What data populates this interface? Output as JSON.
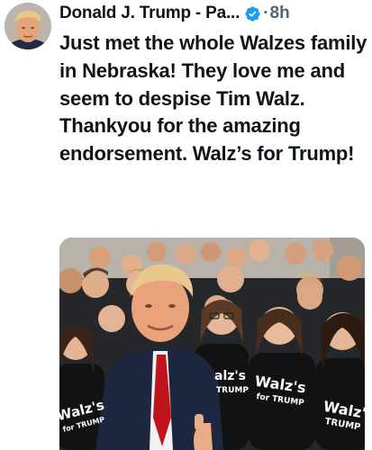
{
  "post": {
    "author_name": "Donald J. Trump - Pa...",
    "separator": "·",
    "timestamp": "8h",
    "text": "Just met the whole Walzes family in Nebraska! They love me and seem to despise Tim Walz. Thankyou for the amazing endorsement. Walz’s for Trump!"
  },
  "icons": {
    "verified": "verified-badge-icon"
  },
  "colors": {
    "verified_blue": "#1d9bf0",
    "text_primary": "#0f1419",
    "text_secondary": "#536471"
  },
  "media": {
    "shirt_texts": [
      {
        "line1": "Walz's",
        "line2": "for TRUMP"
      },
      {
        "line1": "alz's",
        "line2": "TRUMP"
      },
      {
        "line1": "Walz's",
        "line2": "for TRUMP"
      },
      {
        "line1": "Walz's",
        "line2": "TRUMP"
      }
    ]
  }
}
